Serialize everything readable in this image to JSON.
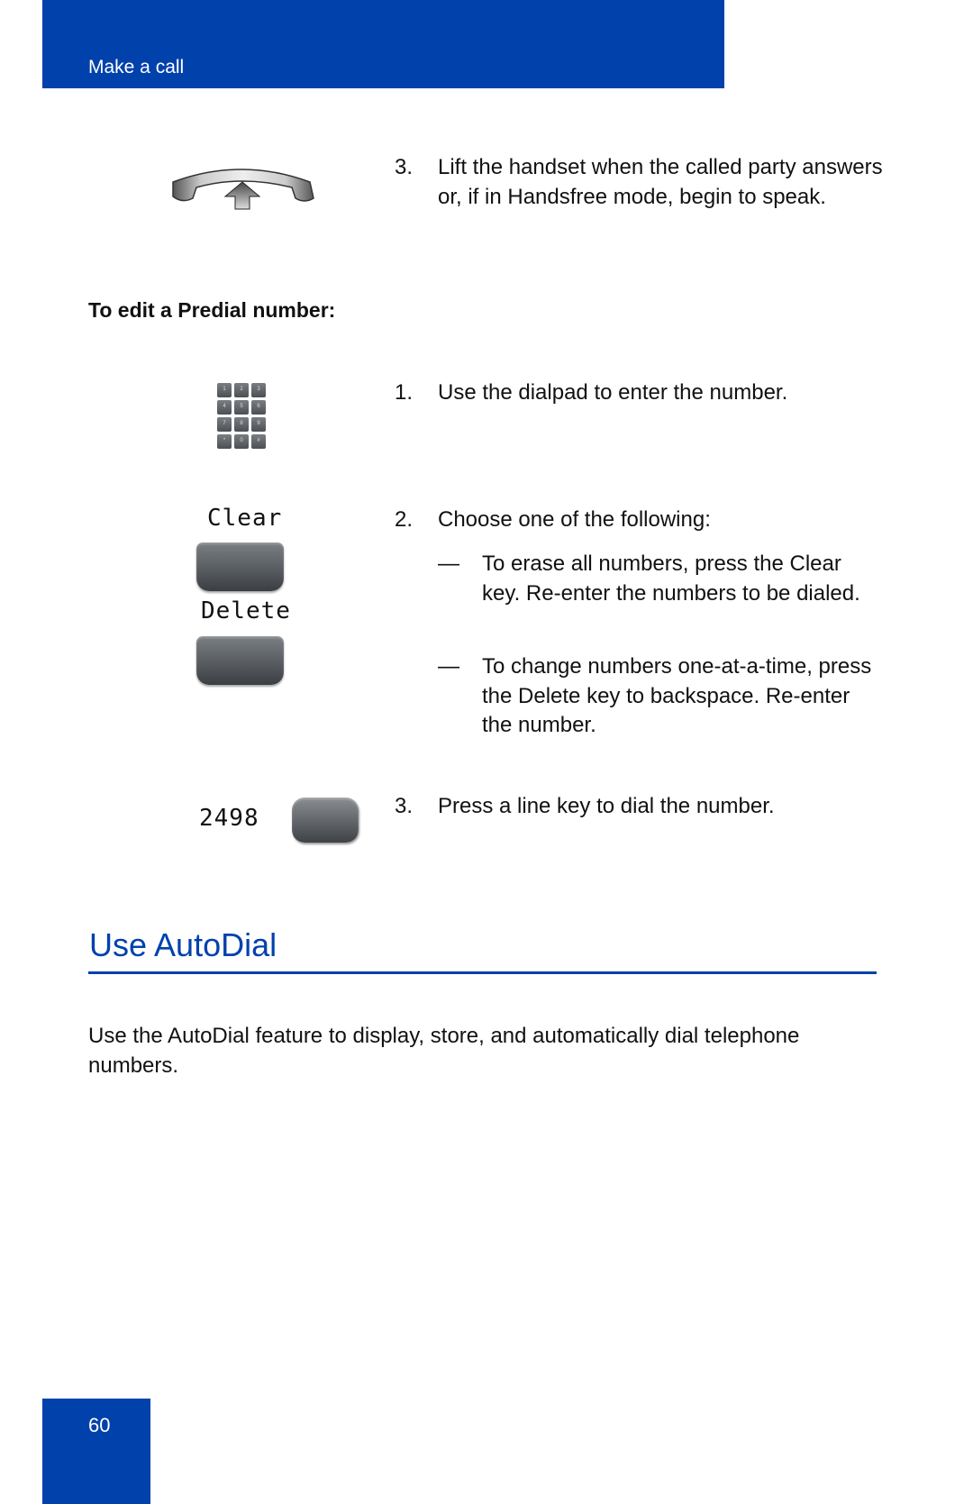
{
  "header": {
    "title": "Make a call",
    "color": "#0041ac"
  },
  "section1": {
    "steps": [
      {
        "number": "3.",
        "icon": "handset-lift-icon",
        "text": "Lift the handset when the called party answers or, if in Handsfree mode, begin to speak."
      }
    ]
  },
  "predial": {
    "subheading": "To edit a Predial number:",
    "steps": [
      {
        "number": "1.",
        "icon": "dialpad-icon",
        "text": "Use the dialpad to enter the number."
      },
      {
        "number": "2.",
        "icon": "softkeys-icon",
        "text": "Choose one of the following:",
        "options": [
          {
            "bullet": "—",
            "text": "To erase all numbers, press the Clear key. Re-enter the numbers to be dialed."
          },
          {
            "bullet": "—",
            "text": "To change numbers one-at-a-time, press the Delete key to backspace. Re-enter the number."
          }
        ]
      },
      {
        "number": "3.",
        "icon": "line-key-icon",
        "text": "Press a line key to dial the number."
      }
    ],
    "softkey_labels": {
      "clear": "Clear",
      "delete": "Delete"
    },
    "display_number": "2498",
    "dialpad_keys": [
      "1",
      "2",
      "3",
      "4",
      "5",
      "6",
      "7",
      "8",
      "9",
      "*",
      "0",
      "#"
    ]
  },
  "autodial": {
    "title": "Use AutoDial",
    "description": "Use the AutoDial feature to display, store, and automatically dial telephone numbers."
  },
  "footer": {
    "page_number": "60"
  }
}
